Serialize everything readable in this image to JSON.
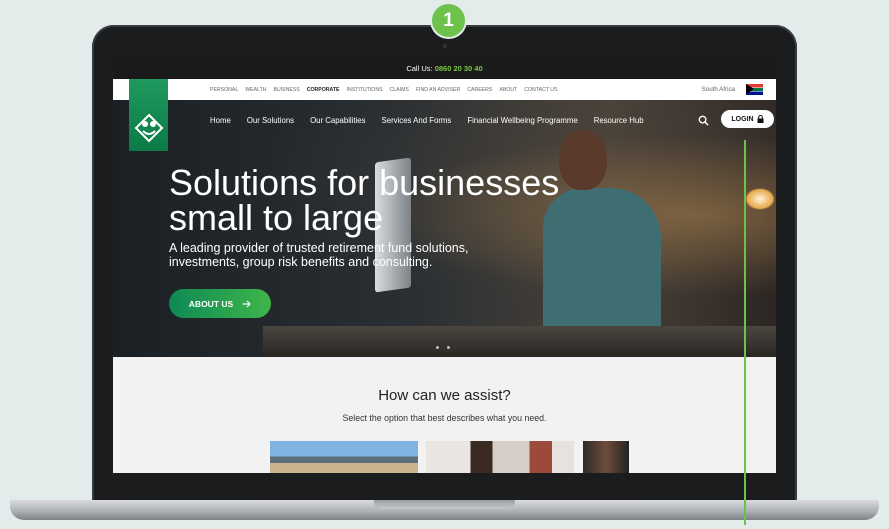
{
  "step_badge": "1",
  "topbar": {
    "call_label": "Call Us:",
    "phone": "0860 20 30 40"
  },
  "subnav": {
    "items": [
      "PERSONAL",
      "WEALTH",
      "BUSINESS",
      "CORPORATE",
      "INSTITUTIONS",
      "CLAIMS",
      "FIND AN ADVISER",
      "CAREERS",
      "ABOUT",
      "CONTACT US"
    ],
    "active": "CORPORATE",
    "country": "South Africa"
  },
  "mainnav": {
    "items": [
      "Home",
      "Our Solutions",
      "Our Capabilities",
      "Services And Forms",
      "Financial Wellbeing Programme",
      "Resource Hub"
    ],
    "login_label": "LOGIN"
  },
  "hero": {
    "title_line1": "Solutions for businesses",
    "title_line2": "small to large",
    "subtitle_line1": "A leading provider of trusted retirement fund solutions,",
    "subtitle_line2": "investments, group risk benefits and consulting.",
    "cta_label": "ABOUT US",
    "slide_count": 2
  },
  "assist": {
    "heading": "How can we assist?",
    "subheading": "Select the option that best describes what you need."
  },
  "colors": {
    "brand_green": "#0b7a47",
    "accent_green": "#6cc24a",
    "phone_green": "#7ac943"
  }
}
